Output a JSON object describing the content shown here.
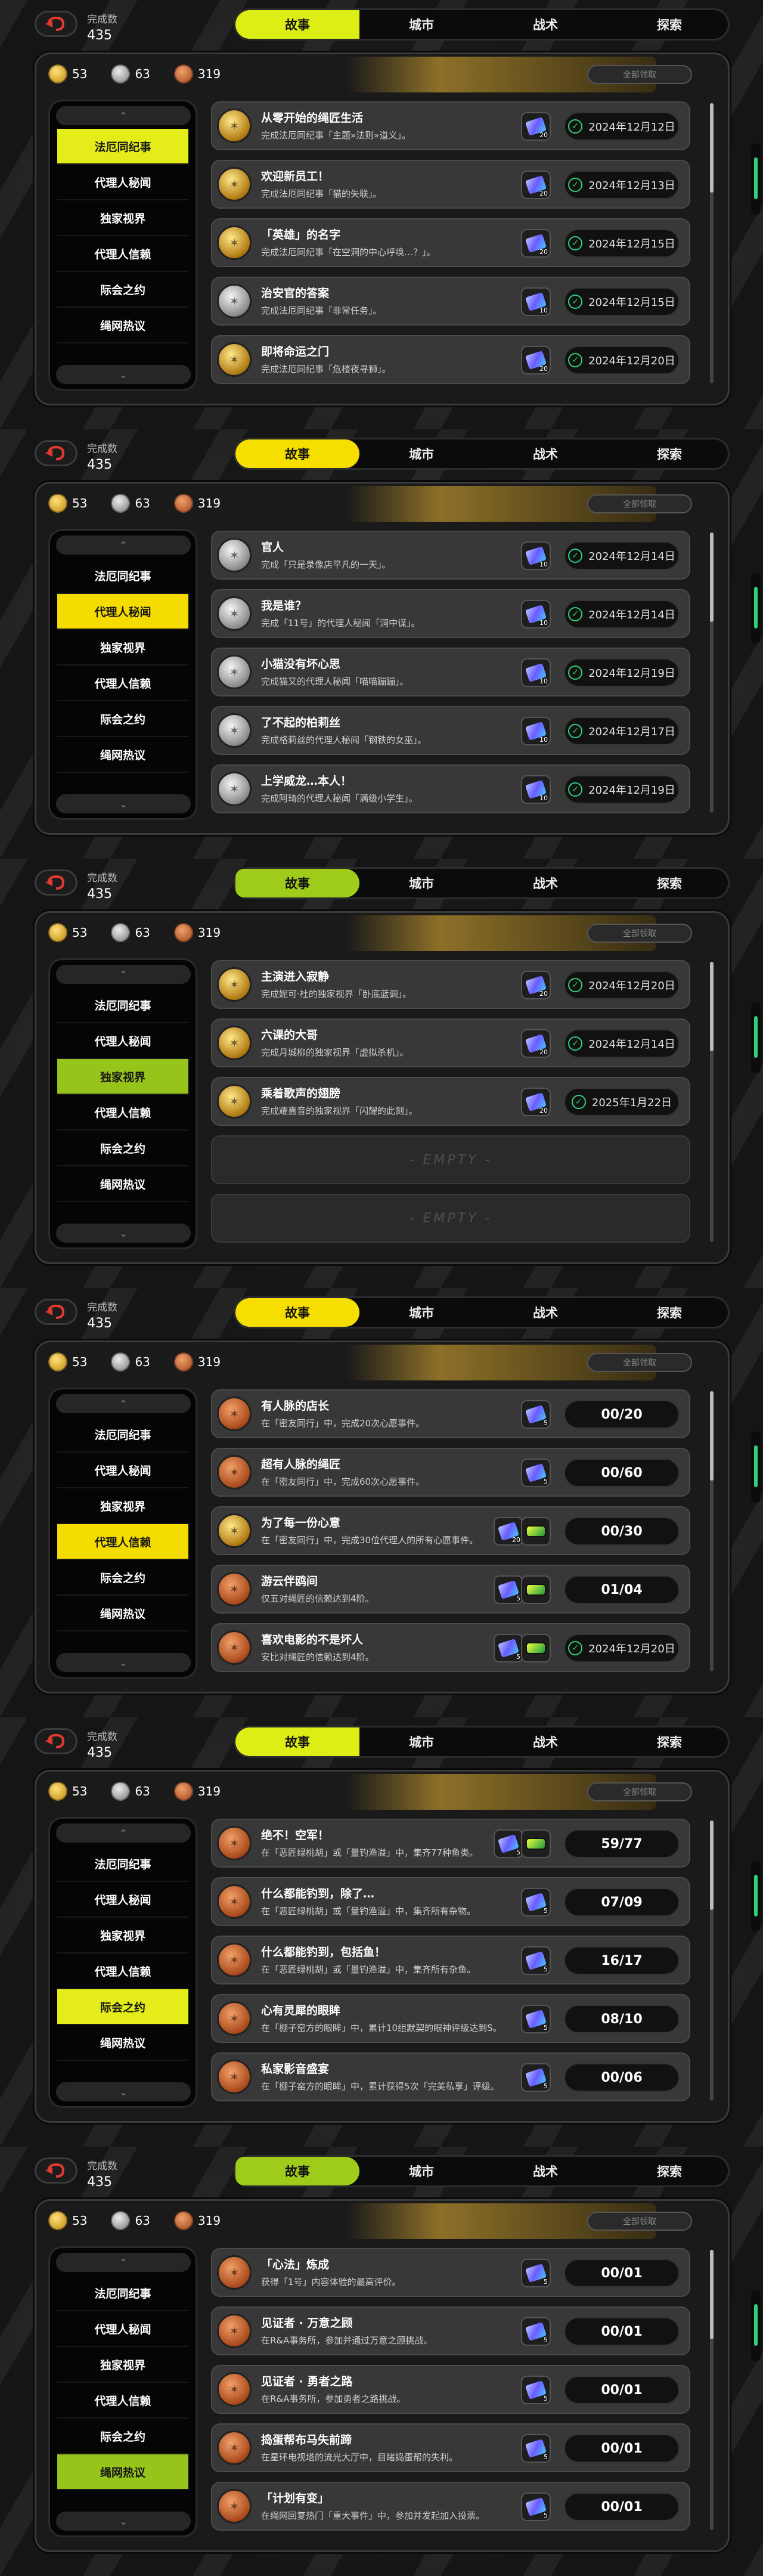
{
  "completion": {
    "label": "完成数",
    "value": "435"
  },
  "tabs": [
    "故事",
    "城市",
    "战术",
    "探索"
  ],
  "currency": [
    {
      "kind": "gold",
      "value": "53"
    },
    {
      "kind": "silver",
      "value": "63"
    },
    {
      "kind": "bronze",
      "value": "319"
    }
  ],
  "claim_all": "全部领取",
  "categories": [
    "法厄同纪事",
    "代理人秘闻",
    "独家视界",
    "代理人信赖",
    "际会之约",
    "绳网热议"
  ],
  "empty_label": "- EMPTY -",
  "colors": {
    "accent_lime": "#dcee16",
    "accent_yellow": "#f5de00",
    "accent_green": "#9fcb1a",
    "check_green": "#2ed17a"
  },
  "panels": [
    {
      "selected_category": 0,
      "style": "a",
      "rows": [
        {
          "medal": "gold",
          "title": "从零开始的绳匠生活",
          "desc": "完成法厄同纪事「主题»法则»道义」。",
          "rewards": [
            {
              "icon": "ticket",
              "count": "20"
            }
          ],
          "status": "date",
          "value": "2024年12月12日"
        },
        {
          "medal": "gold",
          "title": "欢迎新员工！",
          "desc": "完成法厄同纪事「猫的失联」。",
          "rewards": [
            {
              "icon": "ticket",
              "count": "20"
            }
          ],
          "status": "date",
          "value": "2024年12月13日"
        },
        {
          "medal": "gold",
          "title": "「英雄」的名字",
          "desc": "完成法厄同纪事「在空洞的中心呼唤…？」。",
          "rewards": [
            {
              "icon": "ticket",
              "count": "20"
            }
          ],
          "status": "date",
          "value": "2024年12月15日"
        },
        {
          "medal": "silver",
          "title": "治安官的答案",
          "desc": "完成法厄同纪事「非常任务」。",
          "rewards": [
            {
              "icon": "ticket",
              "count": "10"
            }
          ],
          "status": "date",
          "value": "2024年12月15日"
        },
        {
          "medal": "gold",
          "title": "即将命运之门",
          "desc": "完成法厄同纪事「危楼夜寻狮」。",
          "rewards": [
            {
              "icon": "ticket",
              "count": "20"
            }
          ],
          "status": "date",
          "value": "2024年12月20日"
        }
      ]
    },
    {
      "selected_category": 1,
      "style": "b",
      "rows": [
        {
          "medal": "silver",
          "title": "官人",
          "desc": "完成「只是录像店平凡的一天」。",
          "rewards": [
            {
              "icon": "ticket",
              "count": "10"
            }
          ],
          "status": "date",
          "value": "2024年12月14日"
        },
        {
          "medal": "silver",
          "title": "我是谁？",
          "desc": "完成「11号」的代理人秘闻「洞中谋」。",
          "rewards": [
            {
              "icon": "ticket",
              "count": "10"
            }
          ],
          "status": "date",
          "value": "2024年12月14日"
        },
        {
          "medal": "silver",
          "title": "小猫没有坏心思",
          "desc": "完成猫又的代理人秘闻「喵喵蹦蹦」。",
          "rewards": [
            {
              "icon": "ticket",
              "count": "10"
            }
          ],
          "status": "date",
          "value": "2024年12月19日"
        },
        {
          "medal": "silver",
          "title": "了不起的柏莉丝",
          "desc": "完成格莉丝的代理人秘闻「钢铁的女巫」。",
          "rewards": [
            {
              "icon": "ticket",
              "count": "10"
            }
          ],
          "status": "date",
          "value": "2024年12月17日"
        },
        {
          "medal": "silver",
          "title": "上学威龙…本人！",
          "desc": "完成阿琦的代理人秘闻「满级小学生」。",
          "rewards": [
            {
              "icon": "ticket",
              "count": "10"
            }
          ],
          "status": "date",
          "value": "2024年12月19日"
        }
      ]
    },
    {
      "selected_category": 2,
      "style": "c",
      "rows": [
        {
          "medal": "gold",
          "title": "主演进入寂静",
          "desc": "完成妮可·杜的独家视界「卧底蓝调」。",
          "rewards": [
            {
              "icon": "ticket",
              "count": "20"
            }
          ],
          "status": "date",
          "value": "2024年12月20日"
        },
        {
          "medal": "gold",
          "title": "六课的大哥",
          "desc": "完成月城柳的独家视界「虚拟杀机」。",
          "rewards": [
            {
              "icon": "ticket",
              "count": "20"
            }
          ],
          "status": "date",
          "value": "2024年12月14日"
        },
        {
          "medal": "gold",
          "title": "乘着歌声的翅膀",
          "desc": "完成耀嘉音的独家视界「闪耀的此刻」。",
          "rewards": [
            {
              "icon": "ticket",
              "count": "20"
            }
          ],
          "status": "date",
          "value": "2025年1月22日"
        },
        {
          "empty": true
        },
        {
          "empty": true
        }
      ]
    },
    {
      "selected_category": 3,
      "style": "b",
      "rows": [
        {
          "medal": "bronze",
          "title": "有人脉的店长",
          "desc": "在「密友同行」中，完成20次心愿事件。",
          "rewards": [
            {
              "icon": "ticket",
              "count": "5"
            }
          ],
          "status": "progress",
          "value": "00/20"
        },
        {
          "medal": "bronze",
          "title": "超有人脉的绳匠",
          "desc": "在「密友同行」中，完成60次心愿事件。",
          "rewards": [
            {
              "icon": "ticket",
              "count": "5"
            }
          ],
          "status": "progress",
          "value": "00/60"
        },
        {
          "medal": "gold",
          "title": "为了每一份心意",
          "desc": "在「密友同行」中，完成30位代理人的所有心愿事件。",
          "rewards": [
            {
              "icon": "ticket",
              "count": "20"
            },
            {
              "icon": "chip",
              "count": ""
            }
          ],
          "status": "progress",
          "value": "00/30"
        },
        {
          "medal": "bronze",
          "title": "游云伴鸥间",
          "desc": "仅五对绳匠的信赖达到4阶。",
          "rewards": [
            {
              "icon": "ticket",
              "count": "5"
            },
            {
              "icon": "chip",
              "count": ""
            }
          ],
          "status": "progress",
          "value": "01/04"
        },
        {
          "medal": "bronze",
          "title": "喜欢电影的不是坏人",
          "desc": "安比对绳匠的信赖达到4阶。",
          "rewards": [
            {
              "icon": "ticket",
              "count": "5"
            },
            {
              "icon": "chip",
              "count": ""
            }
          ],
          "status": "date",
          "value": "2024年12月20日"
        }
      ]
    },
    {
      "selected_category": 4,
      "style": "a",
      "rows": [
        {
          "medal": "bronze",
          "title": "绝不！空军！",
          "desc": "在「恶匠绿桃胡」或「量钓渔溢」中，集齐77种鱼类。",
          "rewards": [
            {
              "icon": "ticket",
              "count": "5"
            },
            {
              "icon": "chip",
              "count": ""
            }
          ],
          "status": "progress",
          "value": "59/77"
        },
        {
          "medal": "bronze",
          "title": "什么都能钓到，除了…",
          "desc": "在「恶匠绿桃胡」或「量钓渔溢」中，集齐所有杂物。",
          "rewards": [
            {
              "icon": "ticket",
              "count": "5"
            }
          ],
          "status": "progress",
          "value": "07/09"
        },
        {
          "medal": "bronze",
          "title": "什么都能钓到，包括鱼！",
          "desc": "在「恶匠绿桃胡」或「量钓渔溢」中，集齐所有杂鱼。",
          "rewards": [
            {
              "icon": "ticket",
              "count": "5"
            }
          ],
          "status": "progress",
          "value": "16/17"
        },
        {
          "medal": "bronze",
          "title": "心有灵犀的眼眸",
          "desc": "在「棚子窑方的眼眸」中，累计10组默契的眼神评级达到S。",
          "rewards": [
            {
              "icon": "ticket",
              "count": "5"
            }
          ],
          "status": "progress",
          "value": "08/10"
        },
        {
          "medal": "bronze",
          "title": "私家影音盛宴",
          "desc": "在「棚子窑方的眼眸」中，累计获得5次「完美私享」评级。",
          "rewards": [
            {
              "icon": "ticket",
              "count": "5"
            }
          ],
          "status": "progress",
          "value": "00/06"
        }
      ]
    },
    {
      "selected_category": 5,
      "style": "c",
      "rows": [
        {
          "medal": "bronze",
          "title": "「心法」炼成",
          "desc": "获得「1号」内容体验的最高评价。",
          "rewards": [
            {
              "icon": "ticket",
              "count": "5"
            }
          ],
          "status": "progress",
          "value": "00/01"
        },
        {
          "medal": "bronze",
          "title": "见证者 · 万意之顾",
          "desc": "在R&A事务所，参加并通过万意之顾挑战。",
          "rewards": [
            {
              "icon": "ticket",
              "count": "5"
            }
          ],
          "status": "progress",
          "value": "00/01"
        },
        {
          "medal": "bronze",
          "title": "见证者 · 勇者之路",
          "desc": "在R&A事务所，参加勇者之路挑战。",
          "rewards": [
            {
              "icon": "ticket",
              "count": "5"
            }
          ],
          "status": "progress",
          "value": "00/01"
        },
        {
          "medal": "bronze",
          "title": "捣蛋帮布马失前蹄",
          "desc": "在星环电视塔的流光大厅中，目睹捣蛋帮的失利。",
          "rewards": [
            {
              "icon": "ticket",
              "count": "5"
            }
          ],
          "status": "progress",
          "value": "00/01"
        },
        {
          "medal": "bronze",
          "title": "「计划有变」",
          "desc": "在绳网回复热门「重大事件」中，参加并发起加入投票。",
          "rewards": [
            {
              "icon": "ticket",
              "count": "5"
            }
          ],
          "status": "progress",
          "value": "00/01"
        }
      ]
    }
  ]
}
